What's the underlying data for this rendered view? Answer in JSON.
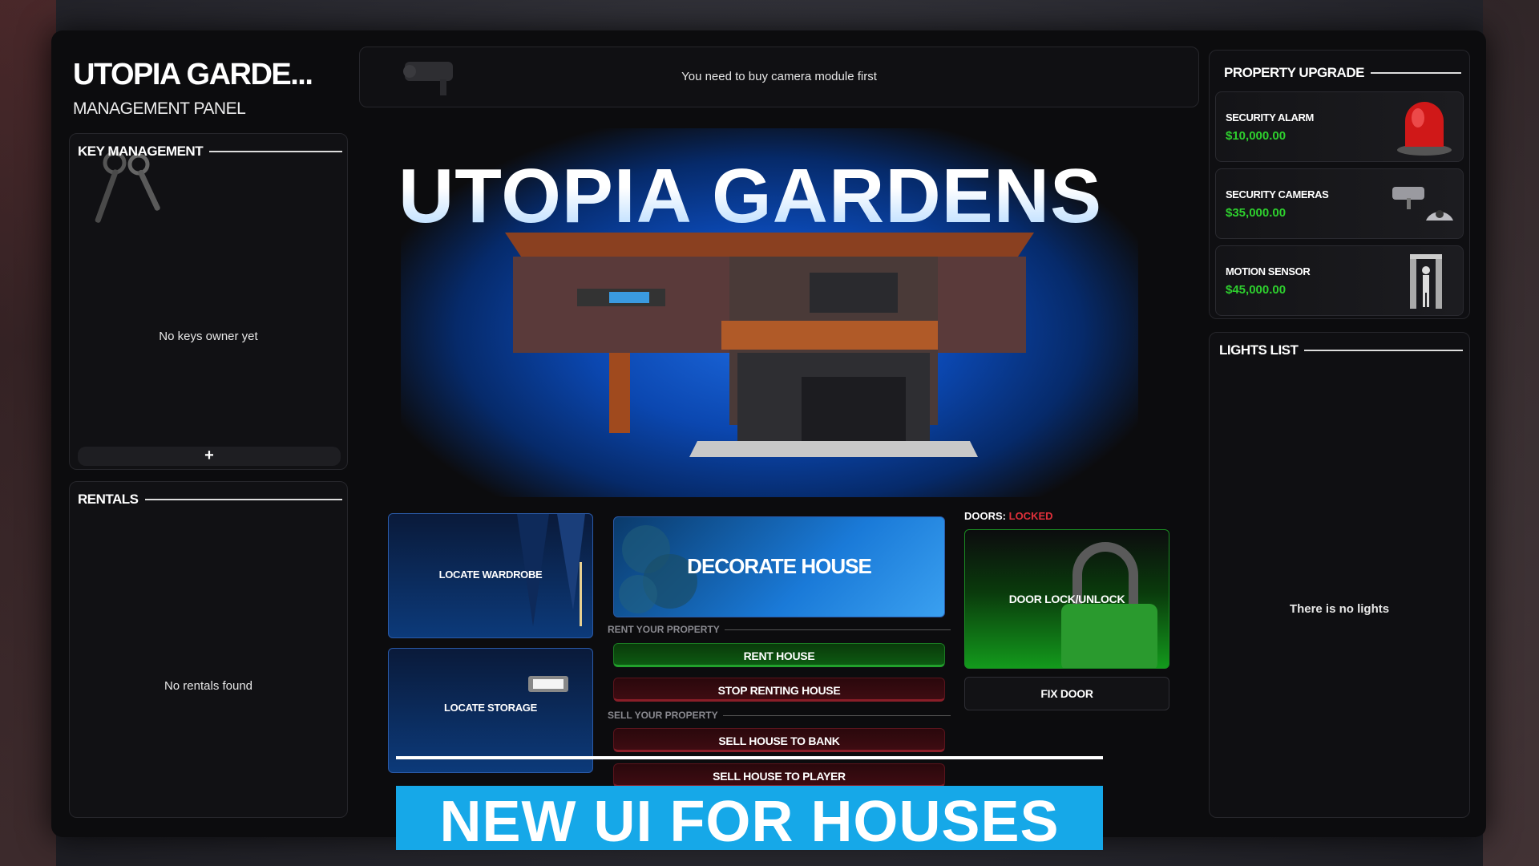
{
  "header": {
    "title": "UTOPIA GARDE...",
    "subtitle": "MANAGEMENT PANEL"
  },
  "notice": {
    "text": "You need to buy camera module first",
    "icon": "camera-icon"
  },
  "key_management": {
    "title": "KEY MANAGEMENT",
    "empty_text": "No keys owner yet",
    "add_label": "+"
  },
  "rentals": {
    "title": "RENTALS",
    "empty_text": "No rentals found"
  },
  "hero": {
    "title": "UTOPIA GARDENS"
  },
  "actions": {
    "locate_wardrobe": "LOCATE WARDROBE",
    "locate_storage": "LOCATE STORAGE",
    "decorate_house": "DECORATE HOUSE",
    "rent_group": "RENT YOUR PROPERTY",
    "rent_house": "RENT HOUSE",
    "stop_renting": "STOP RENTING HOUSE",
    "sell_group": "SELL YOUR PROPERTY",
    "sell_bank": "SELL HOUSE TO BANK",
    "sell_player": "SELL HOUSE TO PLAYER"
  },
  "doors": {
    "label": "DOORS:",
    "status": "LOCKED",
    "status_color": "#e0303a",
    "lock_button": "DOOR LOCK/UNLOCK",
    "fix_button": "FIX DOOR"
  },
  "property_upgrade": {
    "title": "PROPERTY UPGRADE",
    "items": [
      {
        "name": "SECURITY ALARM",
        "price": "$10,000.00",
        "icon": "siren-icon"
      },
      {
        "name": "SECURITY CAMERAS",
        "price": "$35,000.00",
        "icon": "camera-icon"
      },
      {
        "name": "MOTION SENSOR",
        "price": "$45,000.00",
        "icon": "motion-sensor-icon"
      }
    ]
  },
  "lights": {
    "title": "LIGHTS LIST",
    "empty_text": "There is no lights"
  },
  "banner": {
    "text": "NEW UI FOR HOUSES"
  },
  "colors": {
    "accent_blue": "#16a8e8",
    "price_green": "#2ed02e",
    "locked_red": "#e0303a"
  }
}
